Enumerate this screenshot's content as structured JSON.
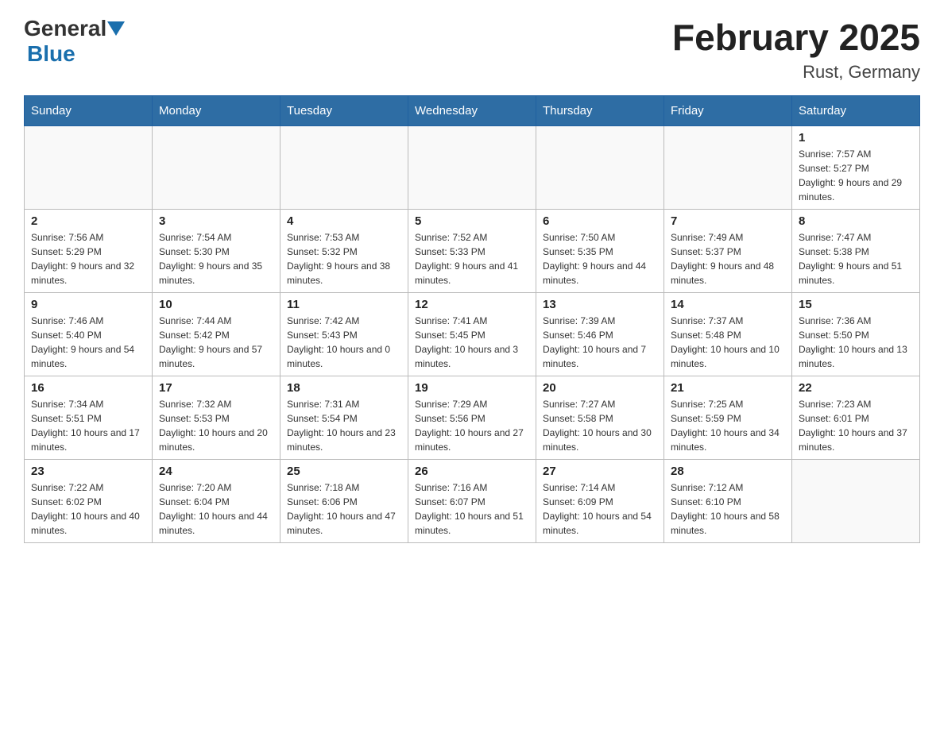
{
  "header": {
    "logo_general": "General",
    "logo_blue": "Blue",
    "title": "February 2025",
    "location": "Rust, Germany"
  },
  "days_of_week": [
    "Sunday",
    "Monday",
    "Tuesday",
    "Wednesday",
    "Thursday",
    "Friday",
    "Saturday"
  ],
  "weeks": [
    [
      {
        "day": "",
        "info": ""
      },
      {
        "day": "",
        "info": ""
      },
      {
        "day": "",
        "info": ""
      },
      {
        "day": "",
        "info": ""
      },
      {
        "day": "",
        "info": ""
      },
      {
        "day": "",
        "info": ""
      },
      {
        "day": "1",
        "info": "Sunrise: 7:57 AM\nSunset: 5:27 PM\nDaylight: 9 hours and 29 minutes."
      }
    ],
    [
      {
        "day": "2",
        "info": "Sunrise: 7:56 AM\nSunset: 5:29 PM\nDaylight: 9 hours and 32 minutes."
      },
      {
        "day": "3",
        "info": "Sunrise: 7:54 AM\nSunset: 5:30 PM\nDaylight: 9 hours and 35 minutes."
      },
      {
        "day": "4",
        "info": "Sunrise: 7:53 AM\nSunset: 5:32 PM\nDaylight: 9 hours and 38 minutes."
      },
      {
        "day": "5",
        "info": "Sunrise: 7:52 AM\nSunset: 5:33 PM\nDaylight: 9 hours and 41 minutes."
      },
      {
        "day": "6",
        "info": "Sunrise: 7:50 AM\nSunset: 5:35 PM\nDaylight: 9 hours and 44 minutes."
      },
      {
        "day": "7",
        "info": "Sunrise: 7:49 AM\nSunset: 5:37 PM\nDaylight: 9 hours and 48 minutes."
      },
      {
        "day": "8",
        "info": "Sunrise: 7:47 AM\nSunset: 5:38 PM\nDaylight: 9 hours and 51 minutes."
      }
    ],
    [
      {
        "day": "9",
        "info": "Sunrise: 7:46 AM\nSunset: 5:40 PM\nDaylight: 9 hours and 54 minutes."
      },
      {
        "day": "10",
        "info": "Sunrise: 7:44 AM\nSunset: 5:42 PM\nDaylight: 9 hours and 57 minutes."
      },
      {
        "day": "11",
        "info": "Sunrise: 7:42 AM\nSunset: 5:43 PM\nDaylight: 10 hours and 0 minutes."
      },
      {
        "day": "12",
        "info": "Sunrise: 7:41 AM\nSunset: 5:45 PM\nDaylight: 10 hours and 3 minutes."
      },
      {
        "day": "13",
        "info": "Sunrise: 7:39 AM\nSunset: 5:46 PM\nDaylight: 10 hours and 7 minutes."
      },
      {
        "day": "14",
        "info": "Sunrise: 7:37 AM\nSunset: 5:48 PM\nDaylight: 10 hours and 10 minutes."
      },
      {
        "day": "15",
        "info": "Sunrise: 7:36 AM\nSunset: 5:50 PM\nDaylight: 10 hours and 13 minutes."
      }
    ],
    [
      {
        "day": "16",
        "info": "Sunrise: 7:34 AM\nSunset: 5:51 PM\nDaylight: 10 hours and 17 minutes."
      },
      {
        "day": "17",
        "info": "Sunrise: 7:32 AM\nSunset: 5:53 PM\nDaylight: 10 hours and 20 minutes."
      },
      {
        "day": "18",
        "info": "Sunrise: 7:31 AM\nSunset: 5:54 PM\nDaylight: 10 hours and 23 minutes."
      },
      {
        "day": "19",
        "info": "Sunrise: 7:29 AM\nSunset: 5:56 PM\nDaylight: 10 hours and 27 minutes."
      },
      {
        "day": "20",
        "info": "Sunrise: 7:27 AM\nSunset: 5:58 PM\nDaylight: 10 hours and 30 minutes."
      },
      {
        "day": "21",
        "info": "Sunrise: 7:25 AM\nSunset: 5:59 PM\nDaylight: 10 hours and 34 minutes."
      },
      {
        "day": "22",
        "info": "Sunrise: 7:23 AM\nSunset: 6:01 PM\nDaylight: 10 hours and 37 minutes."
      }
    ],
    [
      {
        "day": "23",
        "info": "Sunrise: 7:22 AM\nSunset: 6:02 PM\nDaylight: 10 hours and 40 minutes."
      },
      {
        "day": "24",
        "info": "Sunrise: 7:20 AM\nSunset: 6:04 PM\nDaylight: 10 hours and 44 minutes."
      },
      {
        "day": "25",
        "info": "Sunrise: 7:18 AM\nSunset: 6:06 PM\nDaylight: 10 hours and 47 minutes."
      },
      {
        "day": "26",
        "info": "Sunrise: 7:16 AM\nSunset: 6:07 PM\nDaylight: 10 hours and 51 minutes."
      },
      {
        "day": "27",
        "info": "Sunrise: 7:14 AM\nSunset: 6:09 PM\nDaylight: 10 hours and 54 minutes."
      },
      {
        "day": "28",
        "info": "Sunrise: 7:12 AM\nSunset: 6:10 PM\nDaylight: 10 hours and 58 minutes."
      },
      {
        "day": "",
        "info": ""
      }
    ]
  ]
}
